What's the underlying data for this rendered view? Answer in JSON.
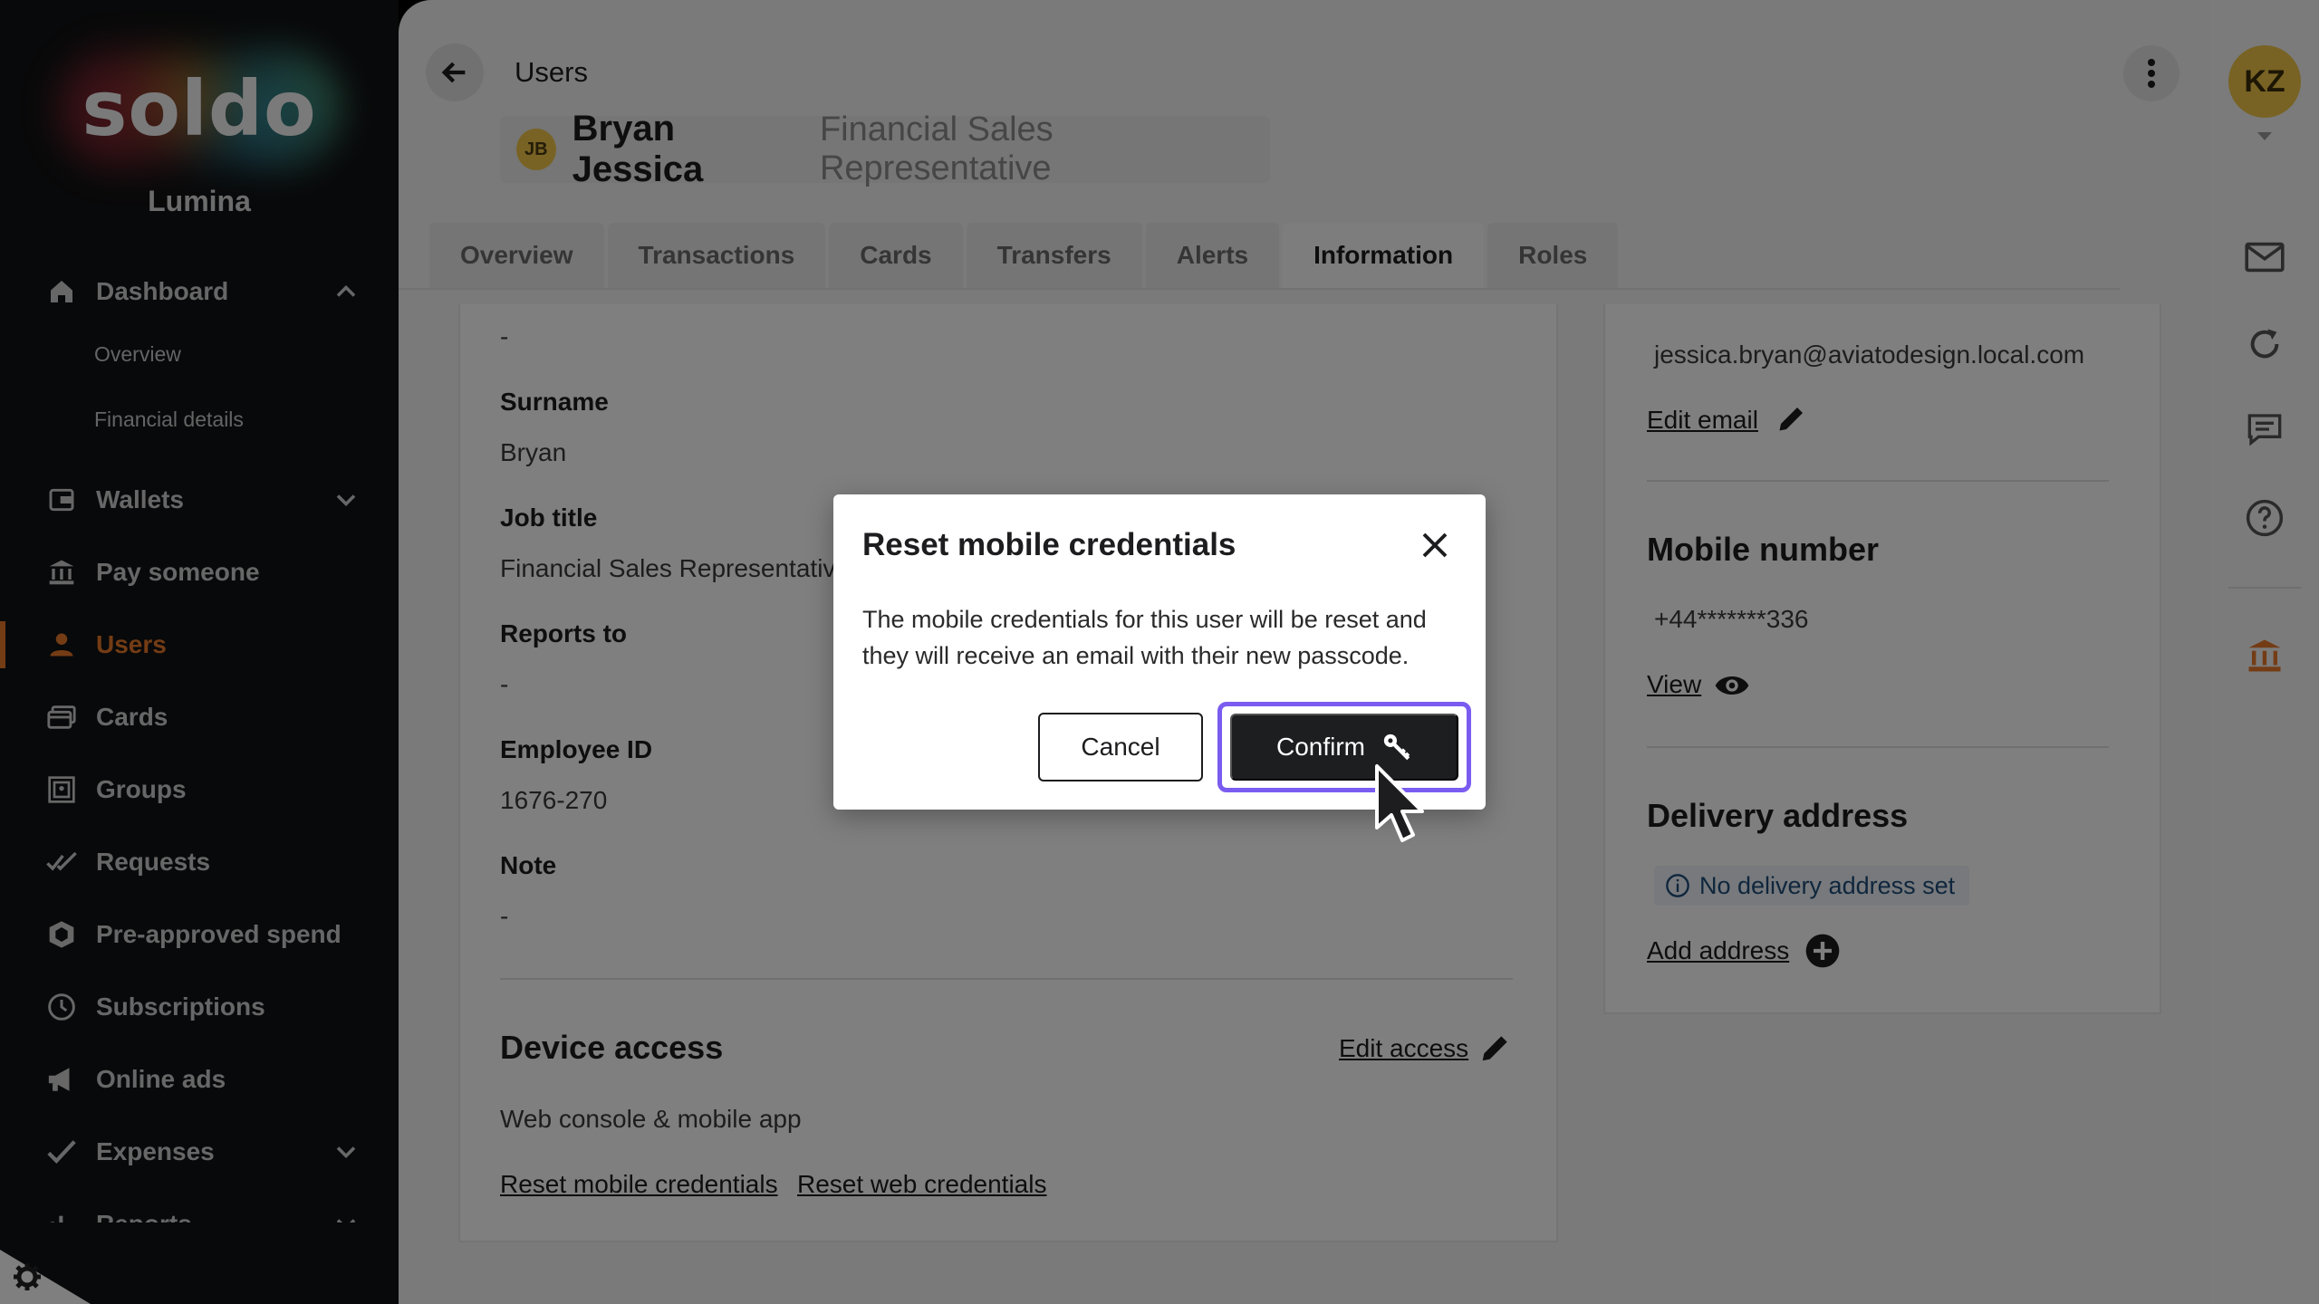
{
  "sidebar": {
    "logo_text": "soldo",
    "org_name": "Lumina",
    "items": [
      {
        "label": "Dashboard",
        "icon": "home-icon"
      },
      {
        "label": "Wallets",
        "icon": "wallet-icon"
      },
      {
        "label": "Pay someone",
        "icon": "bank-transfer-icon"
      },
      {
        "label": "Users",
        "icon": "user-icon"
      },
      {
        "label": "Cards",
        "icon": "cards-icon"
      },
      {
        "label": "Groups",
        "icon": "groups-icon"
      },
      {
        "label": "Requests",
        "icon": "requests-icon"
      },
      {
        "label": "Pre-approved spend",
        "icon": "preapproved-icon"
      },
      {
        "label": "Subscriptions",
        "icon": "clock-icon"
      },
      {
        "label": "Online ads",
        "icon": "megaphone-icon"
      },
      {
        "label": "Expenses",
        "icon": "check-icon"
      },
      {
        "label": "Reports",
        "icon": "reports-icon"
      }
    ],
    "dashboard_sub": [
      "Overview",
      "Financial details"
    ]
  },
  "header": {
    "breadcrumb": "Users",
    "user_initials": "JB",
    "user_name": "Bryan Jessica",
    "user_role": "Financial Sales Representative"
  },
  "tabs": [
    "Overview",
    "Transactions",
    "Cards",
    "Transfers",
    "Alerts",
    "Information",
    "Roles"
  ],
  "active_tab": "Information",
  "info": {
    "top_value": "-",
    "surname_label": "Surname",
    "surname_value": "Bryan",
    "job_title_label": "Job title",
    "job_title_value": "Financial Sales Representative",
    "reports_to_label": "Reports to",
    "reports_to_value": "-",
    "employee_id_label": "Employee ID",
    "employee_id_value": "1676-270",
    "note_label": "Note",
    "note_value": "-"
  },
  "device_access": {
    "title": "Device access",
    "edit_link": "Edit access",
    "value": "Web console & mobile app",
    "reset_mobile": "Reset mobile credentials",
    "reset_web": "Reset web credentials"
  },
  "contact": {
    "email": "jessica.bryan@aviatodesign.local.com",
    "edit_email": "Edit email",
    "mobile_title": "Mobile number",
    "mobile_value": "+44*******336",
    "view_link": "View",
    "delivery_title": "Delivery address",
    "no_address": "No delivery address set",
    "add_address": "Add address"
  },
  "rail": {
    "avatar_initials": "KZ"
  },
  "dialog": {
    "title": "Reset mobile credentials",
    "body": "The mobile credentials for this user will be reset and they will receive an email with their new passcode.",
    "cancel": "Cancel",
    "confirm": "Confirm"
  },
  "colors": {
    "accent": "#e8782a",
    "focus_ring": "#7a5cf0",
    "avatar": "#f0c74a"
  }
}
